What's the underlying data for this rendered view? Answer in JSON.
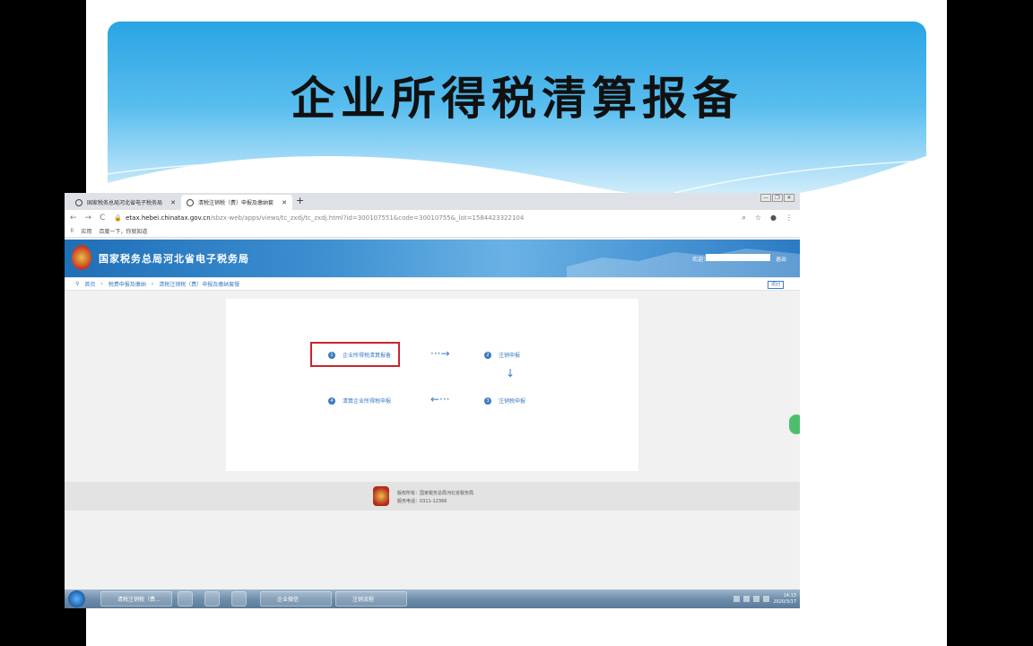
{
  "slide": {
    "title": "企业所得税清算报备"
  },
  "browser": {
    "tabs": [
      {
        "label": "国家税务总局河北省电子税务局"
      },
      {
        "label": "清税注销税（费）申报及缴纳套"
      }
    ],
    "new_tab": "+",
    "window_buttons": [
      "—",
      "❐",
      "✕"
    ],
    "url_host": "etax.hebei.chinatax.gov.cn",
    "url_path": "/sbzx-web/apps/views/tc_zxdj/tc_zxdj.html?id=300107551&code=30010755&_lot=1584423322104",
    "bookmarks": [
      "应用",
      "百度一下，你就知道"
    ]
  },
  "site": {
    "name": "国家税务总局河北省电子税务局",
    "welcome": "欢迎：",
    "logout": "退出",
    "breadcrumb": [
      "首页",
      "税费申报及缴纳",
      "清税注销税（费）申报及缴纳套餐"
    ],
    "back": "返回"
  },
  "steps": [
    {
      "num": "1",
      "label": "企业所得税清算报备"
    },
    {
      "num": "2",
      "label": "注销申报"
    },
    {
      "num": "3",
      "label": "注销税申报"
    },
    {
      "num": "4",
      "label": "清算企业所得税申报"
    }
  ],
  "footer": {
    "copyright": "版权所有：国家税务总局河北省税务局",
    "phone": "服务电话：0311-12366"
  },
  "taskbar": {
    "items": [
      "清税注销税（费...",
      "企业微信",
      "注销流程"
    ],
    "time": "14:13",
    "date": "2020/3/17"
  },
  "colors": {
    "accent": "#3a7cc1",
    "highlight": "#c9242b"
  }
}
